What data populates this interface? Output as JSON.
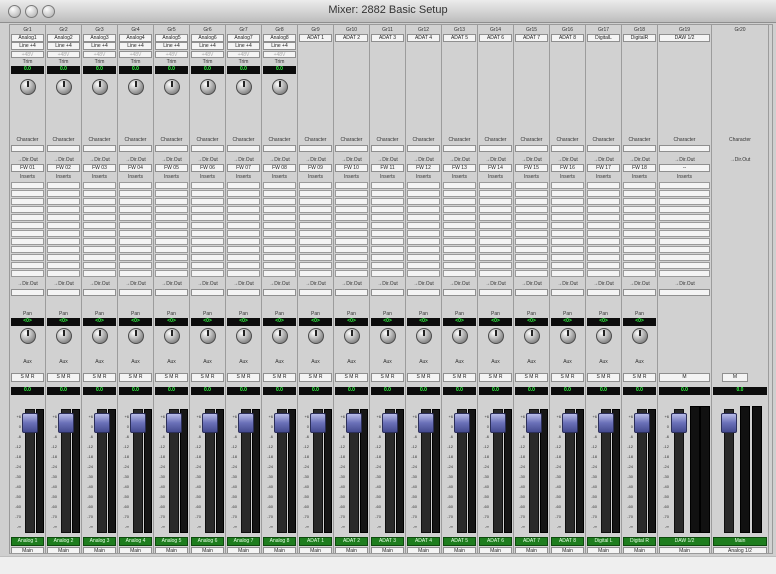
{
  "window": {
    "title": "Mixer: 2882 Basic Setup"
  },
  "strips": [
    {
      "header": "Gr1",
      "input": "Analog1",
      "pad": "Line +4",
      "gain": "+48V",
      "trim": "0.0",
      "dir": "FW 01",
      "dir2": "",
      "pan": "<0>",
      "buttons": "S M R",
      "level": "0.0",
      "name": "Analog 1",
      "output": "Main",
      "kind": "analog"
    },
    {
      "header": "Gr2",
      "input": "Analog2",
      "pad": "Line +4",
      "gain": "+48V",
      "trim": "0.0",
      "dir": "FW 02",
      "dir2": "",
      "pan": "<0>",
      "buttons": "S M R",
      "level": "0.0",
      "name": "Analog 2",
      "output": "Main",
      "kind": "analog"
    },
    {
      "header": "Gr3",
      "input": "Analog3",
      "pad": "Line +4",
      "gain": "+48V",
      "trim": "0.0",
      "dir": "FW 03",
      "dir2": "",
      "pan": "<0>",
      "buttons": "S M R",
      "level": "0.0",
      "name": "Analog 3",
      "output": "Main",
      "kind": "analog"
    },
    {
      "header": "Gr4",
      "input": "Analog4",
      "pad": "Line +4",
      "gain": "+48V",
      "trim": "0.0",
      "dir": "FW 04",
      "dir2": "",
      "pan": "<0>",
      "buttons": "S M R",
      "level": "0.0",
      "name": "Analog 4",
      "output": "Main",
      "kind": "analog"
    },
    {
      "header": "Gr5",
      "input": "Analog5",
      "pad": "Line +4",
      "gain": "+48V",
      "trim": "0.0",
      "dir": "FW 05",
      "dir2": "",
      "pan": "<0>",
      "buttons": "S M R",
      "level": "0.0",
      "name": "Analog 5",
      "output": "Main",
      "kind": "analog"
    },
    {
      "header": "Gr6",
      "input": "Analog6",
      "pad": "Line +4",
      "gain": "+48V",
      "trim": "0.0",
      "dir": "FW 06",
      "dir2": "",
      "pan": "<0>",
      "buttons": "S M R",
      "level": "0.0",
      "name": "Analog 6",
      "output": "Main",
      "kind": "analog"
    },
    {
      "header": "Gr7",
      "input": "Analog7",
      "pad": "Line +4",
      "gain": "+48V",
      "trim": "0.0",
      "dir": "FW 07",
      "dir2": "",
      "pan": "<0>",
      "buttons": "S M R",
      "level": "0.0",
      "name": "Analog 7",
      "output": "Main",
      "kind": "analog"
    },
    {
      "header": "Gr8",
      "input": "Analog8",
      "pad": "Line +4",
      "gain": "+48V",
      "trim": "0.0",
      "dir": "FW 08",
      "dir2": "",
      "pan": "<0>",
      "buttons": "S M R",
      "level": "0.0",
      "name": "Analog 8",
      "output": "Main",
      "kind": "analog"
    },
    {
      "header": "Gr9",
      "input": "ADAT 1",
      "dir": "FW 09",
      "pan": "<0>",
      "buttons": "S M R",
      "level": "0.0",
      "name": "ADAT 1",
      "output": "Main",
      "kind": "adat"
    },
    {
      "header": "Gr10",
      "input": "ADAT 2",
      "dir": "FW 10",
      "pan": "<0>",
      "buttons": "S M R",
      "level": "0.0",
      "name": "ADAT 2",
      "output": "Main",
      "kind": "adat"
    },
    {
      "header": "Gr11",
      "input": "ADAT 3",
      "dir": "FW 11",
      "pan": "<0>",
      "buttons": "S M R",
      "level": "0.0",
      "name": "ADAT 3",
      "output": "Main",
      "kind": "adat"
    },
    {
      "header": "Gr12",
      "input": "ADAT 4",
      "dir": "FW 12",
      "pan": "<0>",
      "buttons": "S M R",
      "level": "0.0",
      "name": "ADAT 4",
      "output": "Main",
      "kind": "adat"
    },
    {
      "header": "Gr13",
      "input": "ADAT 5",
      "dir": "FW 13",
      "pan": "<0>",
      "buttons": "S M R",
      "level": "0.0",
      "name": "ADAT 5",
      "output": "Main",
      "kind": "adat"
    },
    {
      "header": "Gr14",
      "input": "ADAT 6",
      "dir": "FW 14",
      "pan": "<0>",
      "buttons": "S M R",
      "level": "0.0",
      "name": "ADAT 6",
      "output": "Main",
      "kind": "adat"
    },
    {
      "header": "Gr15",
      "input": "ADAT 7",
      "dir": "FW 15",
      "pan": "<0>",
      "buttons": "S M R",
      "level": "0.0",
      "name": "ADAT 7",
      "output": "Main",
      "kind": "adat"
    },
    {
      "header": "Gr16",
      "input": "ADAT 8",
      "dir": "FW 16",
      "pan": "<0>",
      "buttons": "S M R",
      "level": "0.0",
      "name": "ADAT 8",
      "output": "Main",
      "kind": "adat"
    },
    {
      "header": "Gr17",
      "input": "DigitalL",
      "dir": "FW 17",
      "pan": "<0>",
      "buttons": "S M R",
      "level": "0.0",
      "name": "Digital L",
      "output": "Main",
      "kind": "adat"
    },
    {
      "header": "Gr18",
      "input": "DigitalR",
      "dir": "FW 18",
      "pan": "<0>",
      "buttons": "S M R",
      "level": "0.0",
      "name": "Digital R",
      "output": "Main",
      "kind": "adat"
    },
    {
      "header": "Gr19",
      "input": "DAW 1/2",
      "dir": "--",
      "buttons": "M",
      "level": "0.0",
      "name": "DAW 1/2",
      "output": "Main",
      "kind": "daw"
    },
    {
      "header": "Gr20",
      "buttons": "M",
      "level": "0.0",
      "name": "Main",
      "output": "Analog 1/2",
      "kind": "main"
    }
  ],
  "labels": {
    "trim": "Trim",
    "character": "Character",
    "dirout": "→Dir.Out",
    "inserts": "Inserts",
    "dirout2": "→Dir.Out",
    "pan": "Pan",
    "aux": "Aux",
    "dots": "••"
  },
  "scale": [
    "+6",
    "0",
    "-6",
    "-12",
    "-18",
    "-24",
    "-30",
    "-40",
    "-50",
    "-60",
    "-70",
    "-∞"
  ]
}
